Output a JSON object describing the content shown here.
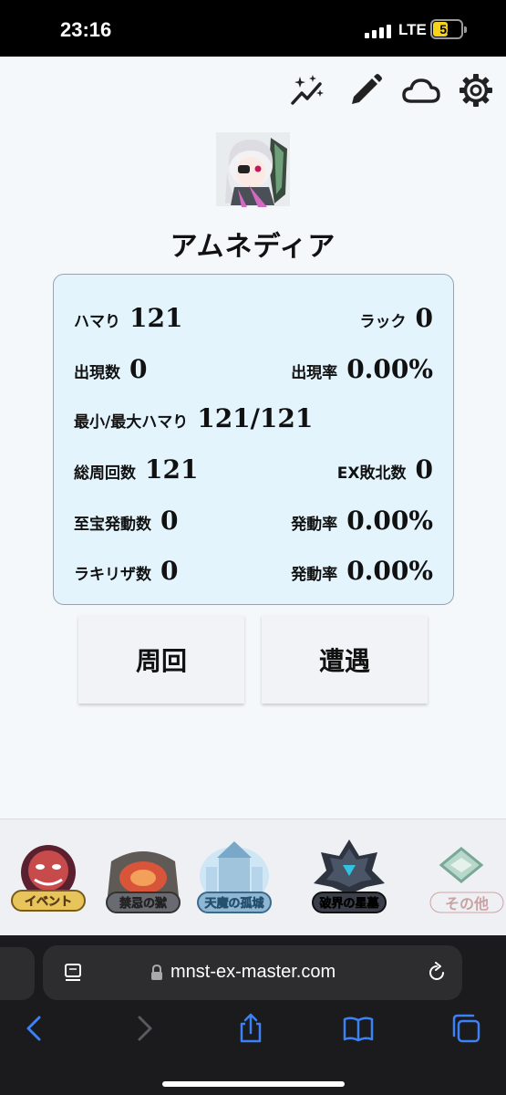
{
  "status_bar": {
    "time": "23:16",
    "network": "LTE",
    "battery": "52",
    "battery_level": 0.52
  },
  "toolbar": {
    "icons": [
      "sparkle-chart-icon",
      "pencil-icon",
      "cloud-icon",
      "gear-icon"
    ]
  },
  "monster": {
    "name": "アムネディア"
  },
  "stats": {
    "hamari_label": "ハマり",
    "hamari_value": "121",
    "luck_label": "ラック",
    "luck_value": "0",
    "appear_count_label": "出現数",
    "appear_count_value": "0",
    "appear_rate_label": "出現率",
    "appear_rate_value": "0.00%",
    "minmax_label": "最小/最大ハマり",
    "minmax_value": "121/121",
    "total_laps_label": "総周回数",
    "total_laps_value": "121",
    "ex_defeat_label": "EX敗北数",
    "ex_defeat_value": "0",
    "treasure_label": "至宝発動数",
    "treasure_value": "0",
    "treasure_rate_label": "発動率",
    "treasure_rate_value": "0.00%",
    "lucky_skill_label": "ラキリザ数",
    "lucky_skill_value": "0",
    "lucky_rate_label": "発動率",
    "lucky_rate_value": "0.00%"
  },
  "buttons": {
    "lap": "周回",
    "encounter": "遭遇"
  },
  "categories": [
    {
      "label": "イベント",
      "icon": "event-icon"
    },
    {
      "label": "禁忌の獄",
      "icon": "forbidden-prison-icon"
    },
    {
      "label": "天魔の孤城",
      "icon": "tenma-castle-icon"
    },
    {
      "label": "破界の星墓",
      "icon": "hakai-star-tomb-icon"
    },
    {
      "label": "その他",
      "icon": "other-icon"
    }
  ],
  "browser": {
    "url": "mnst-ex-master.com"
  },
  "colors": {
    "card_bg": "#e3f4fd",
    "card_border": "#9aa3ad",
    "battery": "#f5d21c",
    "browser_bg": "#1b1b1d",
    "ios_blue": "#3b82f6"
  }
}
